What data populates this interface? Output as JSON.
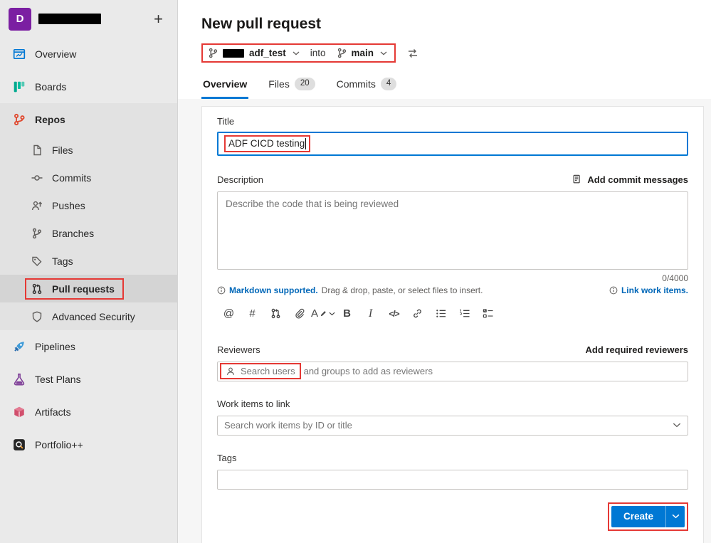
{
  "colors": {
    "accent": "#0078d4",
    "annotation": "#e53935",
    "link": "#0067b8",
    "avatar": "#7b1fa2"
  },
  "sidebar": {
    "project_initial": "D",
    "add_button_label": "+",
    "items": [
      {
        "label": "Overview",
        "icon": "overview-icon"
      },
      {
        "label": "Boards",
        "icon": "boards-icon"
      },
      {
        "label": "Repos",
        "icon": "repos-icon"
      },
      {
        "label": "Files",
        "icon": "files-icon"
      },
      {
        "label": "Commits",
        "icon": "commits-icon"
      },
      {
        "label": "Pushes",
        "icon": "pushes-icon"
      },
      {
        "label": "Branches",
        "icon": "branches-icon"
      },
      {
        "label": "Tags",
        "icon": "tags-icon"
      },
      {
        "label": "Pull requests",
        "icon": "pull-requests-icon",
        "selected": true
      },
      {
        "label": "Advanced Security",
        "icon": "advanced-security-icon"
      },
      {
        "label": "Pipelines",
        "icon": "pipelines-icon"
      },
      {
        "label": "Test Plans",
        "icon": "test-plans-icon"
      },
      {
        "label": "Artifacts",
        "icon": "artifacts-icon"
      },
      {
        "label": "Portfolio++",
        "icon": "portfolio-icon"
      }
    ]
  },
  "header": {
    "page_title": "New pull request",
    "source_branch": "adf_test",
    "into_label": "into",
    "target_branch": "main",
    "tabs": [
      {
        "label": "Overview"
      },
      {
        "label": "Files",
        "badge": "20"
      },
      {
        "label": "Commits",
        "badge": "4"
      }
    ]
  },
  "form": {
    "title_label": "Title",
    "title_value": "ADF CICD testing",
    "description_label": "Description",
    "add_commit_messages_label": "Add commit messages",
    "description_placeholder": "Describe the code that is being reviewed",
    "char_counter": "0/4000",
    "markdown_link": "Markdown supported.",
    "markdown_hint": "Drag & drop, paste, or select files to insert.",
    "link_work_items_label": "Link work items.",
    "toolbar_glyphs": {
      "mention": "@",
      "work_item": "#",
      "format": "A",
      "bold": "B",
      "italic": "I",
      "code": "</>"
    },
    "reviewers_label": "Reviewers",
    "add_required_reviewers_label": "Add required reviewers",
    "reviewers_placeholder_highlight": "Search users",
    "reviewers_placeholder_rest": "and groups to add as reviewers",
    "work_items_label": "Work items to link",
    "work_items_placeholder": "Search work items by ID or title",
    "tags_label": "Tags",
    "create_label": "Create"
  }
}
